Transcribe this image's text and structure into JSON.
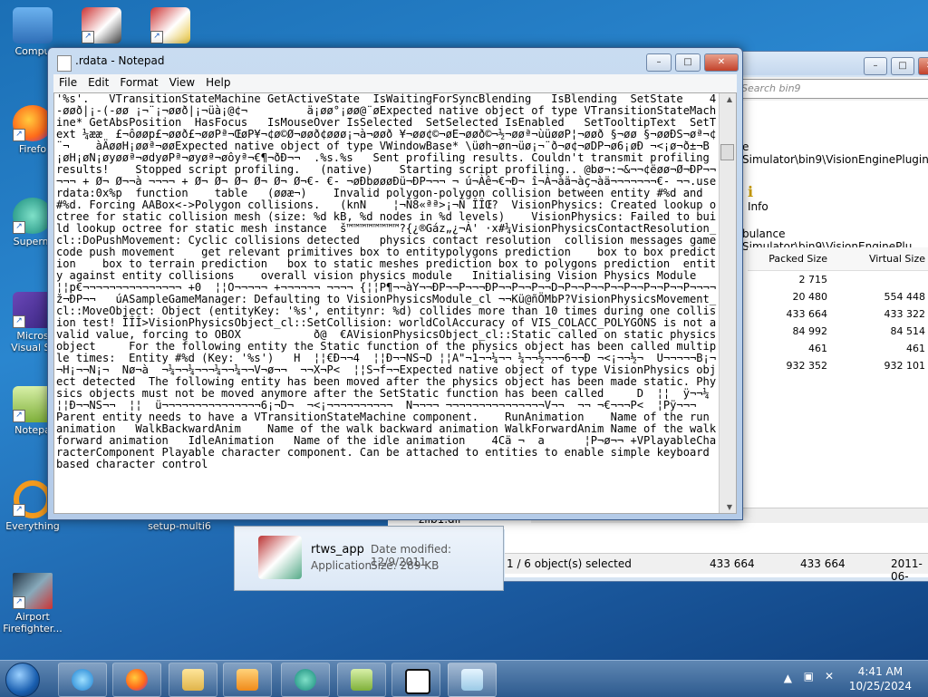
{
  "desktop": {
    "icons": [
      {
        "label": "Compu"
      },
      {
        "label": "Firefo"
      },
      {
        "label": "Superm"
      },
      {
        "label": "Micros\nVisual St"
      },
      {
        "label": "Notepa"
      },
      {
        "label": "Everything"
      },
      {
        "label": "setup-multi6"
      },
      {
        "label": "Airport\nFirefighter..."
      }
    ]
  },
  "notepad": {
    "title": ".rdata - Notepad",
    "menu": [
      "File",
      "Edit",
      "Format",
      "View",
      "Help"
    ],
    "content": "'%s'.   VTransitionStateMachine GetActiveState  IsWaitingForSyncBlending   IsBlending  SetState    4-øøð|¡-(-øø ¡¬¨¡¬øøð|¡¬üà¡@¢¬         ä¡øø°¡øø@¨øExpected native object of type VTransitionStateMachine* GetAbsPosition  HasFocus   IsMouseOver IsSelected  SetSelected IsEnabled   SetTooltipText  SetText ¼ææ  £¬ôøøp£¬øøð£¬øøPª¬ŒøP¥¬¢ø©Ø¬øøð¢øøø¡¬à¬øøð ¥¬øø¢©¬øE¬øøð©¬½¬øøª¬ùüøøP¦¬øøð §¬øø §¬øøÐS¬øª¬¢¨¬    àÄøøH¡øøª¬øøExpected native object of type VWindowBase* \\üøh¬øn¬üø¡¬¨ð¬ø¢¬øDP¬ø6¡øÐ ¬<¡ø¬ð±¬B¡øH¡øN¡øyøøª¬ødyøPª¬øyøª¬øôyª¬€¶¬ðÐ¬¬  .%s.%s   Sent profiling results. Couldn't transmit profiling results!    Stopped script profiling.   (native)    Starting script profiling.. @bø¬:¬&¬¬¢ëøø¬Ø¬ÐP¬¬¬¬¬ + Ø¬ Ø¬¬à ¬¬¬¬ + Ø¬ Ø¬ Ø¬ Ø¬ Ø¬ Ø¬€- €- ¬øÐbøøøÐü¬ÐP¬¬¬ ¬ ú¬Àê¬€¬Ð¬ î¬À¬àä¬àç¬àä¬¬¬¬¬¬¬€- ¬¬.userdata:0x%p  function    table   (øøæ¬)    Invalid polygon-polygon collision between entity #%d and #%d. Forcing AABox<->Polygon collisions.   (knN    ¦¬Ñ8«ªª>¡¬Ñ ÎÎŒ?  VisionPhysics: Created lookup octree for static collision mesh (size: %d kB, %d nodes in %d levels)    VisionPhysics: Failed to build lookup octree for static mesh instance  š™™™™™™™™?{¿®Gáz„¿¬À' ·x#¼VisionPhysicsContactResolution_cl::DoPushMovement: Cyclic collisions detected   physics contact resolution  collision messages gamecode push movement    get relevant primitives box to entitypolygons prediction    box to box prediction    box to terrain prediction   box to static meshes prediction box to polygons prediction  entity against entity collisions    overall vision physics module   Initialising Vision Physics Module    ¦¦p€¬¬¬¬¬¬¬¬¬¬¬¬¬¬¬ +0  ¦¦O¬¬¬¬¬ +¬¬¬¬¬¬ ¬¬¬¬ {¦¦P¶¬¬àY¬¬ÐP¬¬P¬¬¬ÐP¬¬P¬¬P¬¬D¬P¬¬P¬¬P¬¬P¬¬P¬¬P¬¬P¬¬¬¬ ž¬ÐP¬¬   úASampleGameManager: Defaulting to VisionPhysicsModule_cl ¬¬Kü@ñÖMbP?VisionPhysicsMovement_cl::MoveObject: Object (entityKey: '%s', entitynr: %d) collides more than 10 times during one collision test! ÎÎÎ>VisionPhysicsObject_cl::SetCollision: worldColAccuracy of VIS_COLACC_POLYGONS is not a valid value, forcing to OBOX           ð@  €AVisionPhysicsObject_cl::Static called on static physics object     For the following entity the Static function of the physics object has been called multiple times:  Entity #%d (Key: '%s')   H  ¦¦€Ð¬¬4  ¦¦Ð¬¬NS¬D ¦¦A\"¬1¬¬¼¬¬ ¼¬¬½¬¬¬6¬¬Ð ¬<¡¬¬½¬  U¬¬¬¬¬B¡¬¬H¡¬¬N¡¬  Nø¬à  ¬¼¬¬¼¬¬¬¼¬¬¼¬¬V¬ø¬¬  ¬¬X¬P<  ¦¦S¬f¬¬Expected native object of type VisionPhysics object detected  The following entity has been moved after the physics object has been made static. Physics objects must not be moved anymore after the SetStatic function has been called     D  ¦¦  ÿ¬¬¼  ¦¦Ð¬¬NS¬¬  ¦¦  ü¬¬¬¬¬¬¬¬¬¬¬¬¬¬¬6¡¬D¬  ¬<¡¬¬¬¬¬¬¬¬¬¬  N¬¬¬¬ ¬¬¬¬¬¬¬¬¬¬¬¬¬¬¬V¬¬  ¬¬ ¬€¬¬¬P<  ¦Pÿ¬¬¬    Parent entity needs to have a VTransitionStateMachine component.    RunAnimation    Name of the run animation   WalkBackwardAnim    Name of the walk backward animation WalkForwardAnim Name of the walk forward animation   IdleAnimation   Name of the idle animation    4Cä ¬  a      ¦P¬ø¬¬ +VPlayableCharacterComponent Playable character component. Can be attached to entities to enable simple keyboard based character control"
  },
  "zip": {
    "search_placeholder": "Search bin9",
    "path1": "e Simulator\\bin9\\VisionEnginePlugin.v",
    "info_label": "Info",
    "path2": "bulance Simulator\\bin9\\VisionEnginePlu",
    "columns": [
      "Packed Size",
      "Virtual Size"
    ],
    "rows": [
      [
        "2 715",
        ""
      ],
      [
        "20 480",
        "554 448"
      ],
      [
        "433 664",
        "433 322"
      ],
      [
        "84 992",
        "84 514"
      ],
      [
        "461",
        "461"
      ],
      [
        "932 352",
        "932 101"
      ]
    ],
    "status": [
      "1 / 6 object(s) selected",
      "433 664",
      "433 664",
      "2011-06-"
    ]
  },
  "explorer_preview": {
    "zlib": "zlib1.dll",
    "name": "rtws_app",
    "type": "Application",
    "date_modified": "Date modified: 12/9/2011",
    "size": "Size: 289 KB"
  },
  "taskbar": {
    "time": "4:41 AM",
    "date": "10/25/2024",
    "apps": [
      "internet-explorer",
      "firefox",
      "file-explorer",
      "media-player",
      "vision-app",
      "notepad-plus",
      "7zip",
      "notepad"
    ]
  }
}
